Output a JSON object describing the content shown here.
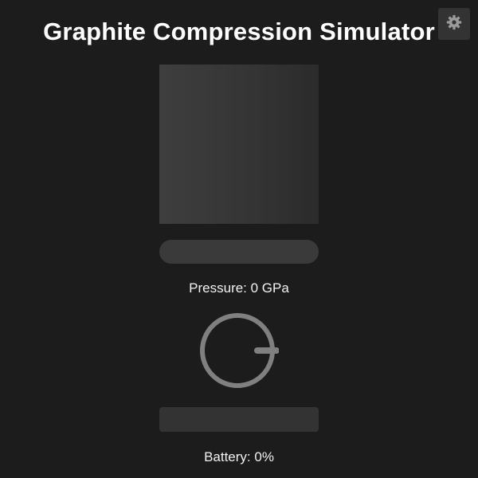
{
  "title": "Graphite Compression Simulator",
  "settings_icon": "gear-icon",
  "pressure": {
    "label": "Pressure: 0 GPa",
    "slider_level": 0
  },
  "knob": {
    "icon": "dial-knob-icon",
    "rotation_deg": 0
  },
  "battery": {
    "label": "Battery: 0%",
    "level": 0
  },
  "colors": {
    "background": "#1c1c1c",
    "panel": "#333333",
    "knob": "#808080",
    "text": "#ffffff"
  }
}
